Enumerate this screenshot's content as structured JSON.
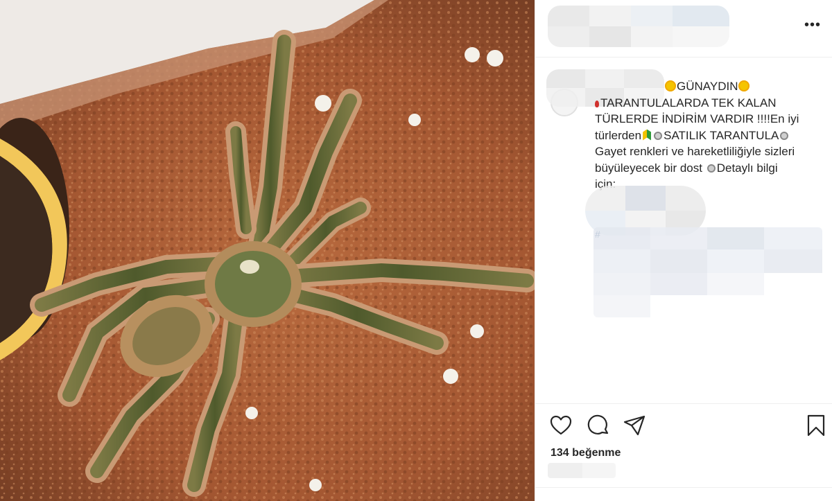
{
  "post": {
    "image_alt": "Tarantula on coco substrate",
    "more_icon": "more-horizontal-icon"
  },
  "caption": {
    "line1_text": "GÜNAYDIN",
    "line2_text": "TARANTULALARDA TEK KALAN",
    "line3_text": "TÜRLERDE İNDİRİM VARDIR !!!!En iyi",
    "line4_pre": "türlerden",
    "line4_mid": "SATILIK TARANTULA",
    "line5_text": "Gayet renkleri ve hareketliliğiyle sizleri",
    "line6_text": "büyüleyecek bir dost",
    "line6_post": "Detaylı bilgi",
    "line7_text": "için:",
    "hashtag_prefix": "#"
  },
  "actions": {
    "like_icon": "heart-icon",
    "comment_icon": "comment-icon",
    "share_icon": "send-icon",
    "save_icon": "bookmark-icon",
    "likes_text": "134 beğenme"
  },
  "colors": {
    "text": "#262626",
    "border": "#efefef",
    "substrate": "#a65a35"
  }
}
